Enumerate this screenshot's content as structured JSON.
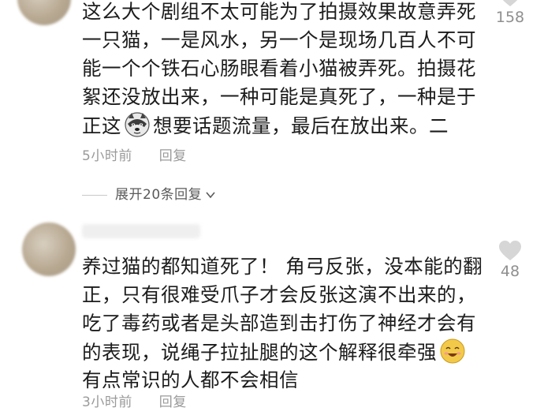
{
  "comments": [
    {
      "lines": [
        "这么大个剧组不太可能为了拍摄效果故意弄死",
        "一只猫，一是风水，另一个是现场几百人不可",
        "能一个个铁石心肠眼看着小猫被弄死。拍摄花",
        "絮还没放出来，一种可能是真死了，一种是于"
      ],
      "last_line_before_emoji": "正这",
      "last_line_after_emoji": "想要话题流量，最后在放出来。二",
      "emoji": "husky-dog-emoji",
      "time": "5小时前",
      "reply_label": "回复",
      "likes": "158"
    },
    {
      "lines": [
        "养过猫的都知道死了！ 角弓反张，没本能的翻",
        "正，只有很难受爪子才会反张这演不出来的，",
        "吃了毒药或者是头部造到击打伤了神经才会有"
      ],
      "last_line_before_emoji": "的表现，说绳子拉扯腿的这个解释很牵强",
      "emoji": "smiling-face-emoji",
      "extra_line": "有点常识的人都不会相信",
      "time": "3小时前",
      "reply_label": "回复",
      "likes": "48"
    }
  ],
  "expand_replies": "展开20条回复"
}
